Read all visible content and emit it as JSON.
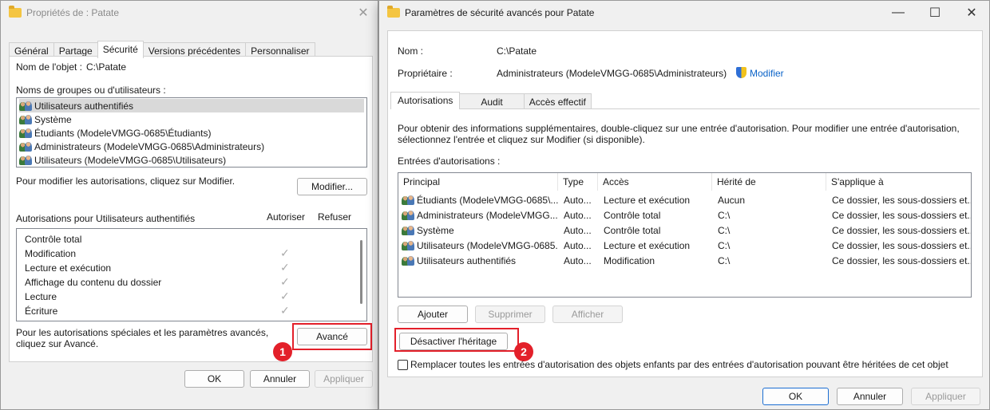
{
  "left": {
    "title": "Propriétés de : Patate",
    "tabs": [
      "Général",
      "Partage",
      "Sécurité",
      "Versions précédentes",
      "Personnaliser"
    ],
    "object_label": "Nom de l'objet :",
    "object_value": "C:\\Patate",
    "groups_label": "Noms de groupes ou d'utilisateurs :",
    "groups": [
      "Utilisateurs authentifiés",
      "Système",
      "Étudiants (ModeleVMGG-0685\\Étudiants)",
      "Administrateurs (ModeleVMGG-0685\\Administrateurs)",
      "Utilisateurs (ModeleVMGG-0685\\Utilisateurs)"
    ],
    "modify_hint": "Pour modifier les autorisations, cliquez sur Modifier.",
    "modify_button": "Modifier...",
    "perm_title": "Autorisations pour Utilisateurs authentifiés",
    "allow_header": "Autoriser",
    "deny_header": "Refuser",
    "permissions": [
      {
        "name": "Contrôle total",
        "allow": false
      },
      {
        "name": "Modification",
        "allow": true
      },
      {
        "name": "Lecture et exécution",
        "allow": true
      },
      {
        "name": "Affichage du contenu du dossier",
        "allow": true
      },
      {
        "name": "Lecture",
        "allow": true
      },
      {
        "name": "Écriture",
        "allow": true
      }
    ],
    "special_hint": "Pour les autorisations spéciales et les paramètres avancés, cliquez sur Avancé.",
    "advanced_button": "Avancé",
    "ok": "OK",
    "cancel": "Annuler",
    "apply": "Appliquer",
    "badge": "1"
  },
  "right": {
    "title": "Paramètres de sécurité avancés pour Patate",
    "name_label": "Nom :",
    "name_value": "C:\\Patate",
    "owner_label": "Propriétaire :",
    "owner_value": "Administrateurs (ModeleVMGG-0685\\Administrateurs)",
    "owner_change": "Modifier",
    "tabs": [
      "Autorisations",
      "Audit",
      "Accès effectif"
    ],
    "info": "Pour obtenir des informations supplémentaires, double-cliquez sur une entrée d'autorisation. Pour modifier une entrée d'autorisation, sélectionnez l'entrée et cliquez sur Modifier (si disponible).",
    "entries_label": "Entrées d'autorisations :",
    "columns": [
      "Principal",
      "Type",
      "Accès",
      "Hérité de",
      "S'applique à"
    ],
    "entries": [
      {
        "principal": "Étudiants (ModeleVMGG-0685\\...",
        "type": "Auto...",
        "access": "Lecture et exécution",
        "inherited": "Aucun",
        "applies": "Ce dossier, les sous-dossiers et..."
      },
      {
        "principal": "Administrateurs (ModeleVMGG...",
        "type": "Auto...",
        "access": "Contrôle total",
        "inherited": "C:\\",
        "applies": "Ce dossier, les sous-dossiers et..."
      },
      {
        "principal": "Système",
        "type": "Auto...",
        "access": "Contrôle total",
        "inherited": "C:\\",
        "applies": "Ce dossier, les sous-dossiers et..."
      },
      {
        "principal": "Utilisateurs (ModeleVMGG-0685...",
        "type": "Auto...",
        "access": "Lecture et exécution",
        "inherited": "C:\\",
        "applies": "Ce dossier, les sous-dossiers et..."
      },
      {
        "principal": "Utilisateurs authentifiés",
        "type": "Auto...",
        "access": "Modification",
        "inherited": "C:\\",
        "applies": "Ce dossier, les sous-dossiers et..."
      }
    ],
    "add_button": "Ajouter",
    "remove_button": "Supprimer",
    "view_button": "Afficher",
    "disable_inheritance": "Désactiver l'héritage",
    "replace_label": "Remplacer toutes les entrées d'autorisation des objets enfants par des entrées d'autorisation pouvant être héritées de cet objet",
    "ok": "OK",
    "cancel": "Annuler",
    "apply": "Appliquer",
    "badge": "2"
  }
}
